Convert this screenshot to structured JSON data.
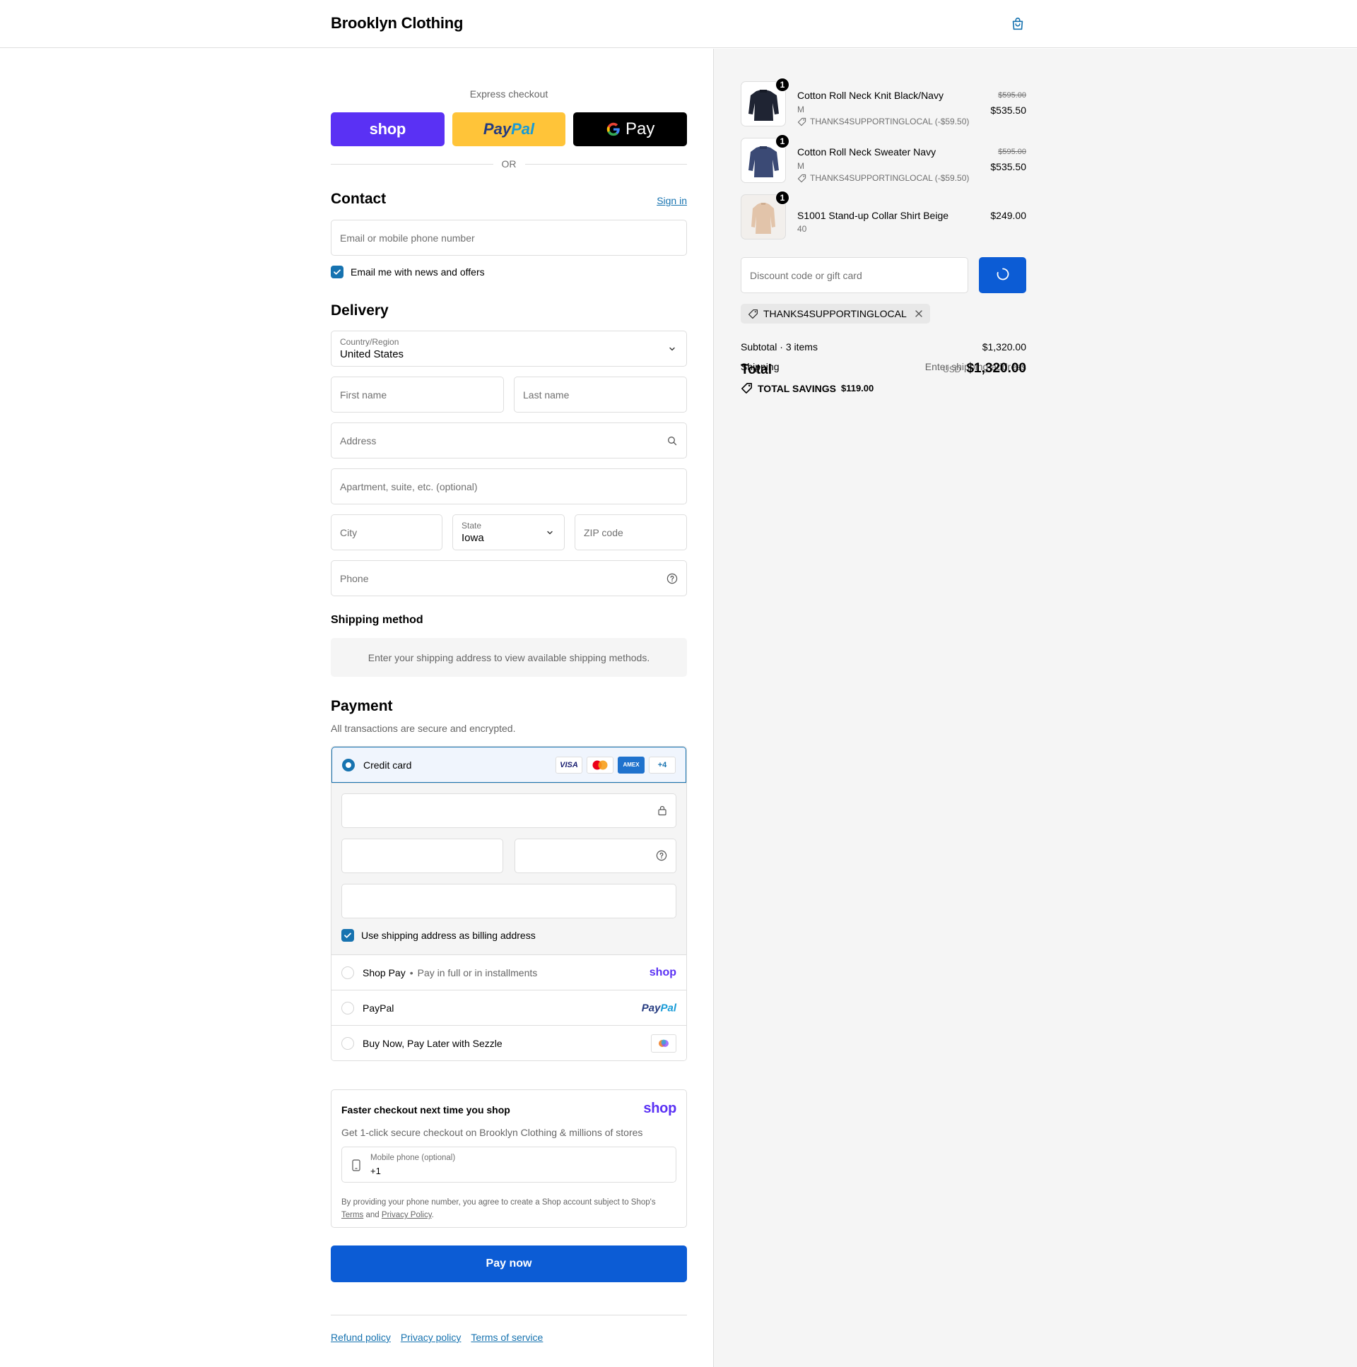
{
  "header": {
    "brand": "Brooklyn Clothing",
    "cart_icon": "shopping-bag-icon"
  },
  "express": {
    "title": "Express checkout",
    "shop_label": "shop",
    "paypal_label_a": "Pay",
    "paypal_label_b": "Pal",
    "gpay_label": "Pay",
    "or_label": "OR"
  },
  "contact": {
    "title": "Contact",
    "sign_in": "Sign in",
    "email_placeholder": "Email or mobile phone number",
    "news_label": "Email me with news and offers",
    "news_checked": true
  },
  "delivery": {
    "title": "Delivery",
    "country_label": "Country/Region",
    "country_value": "United States",
    "first_name_placeholder": "First name",
    "last_name_placeholder": "Last name",
    "address_placeholder": "Address",
    "apartment_placeholder": "Apartment, suite, etc. (optional)",
    "city_placeholder": "City",
    "state_label": "State",
    "state_value": "Iowa",
    "zip_placeholder": "ZIP code",
    "phone_placeholder": "Phone"
  },
  "shipping_method": {
    "title": "Shipping method",
    "message": "Enter your shipping address to view available shipping methods."
  },
  "payment": {
    "title": "Payment",
    "subtitle": "All transactions are secure and encrypted.",
    "options": [
      {
        "label": "Credit card",
        "selected": true
      },
      {
        "label": "Shop Pay",
        "sub": "Pay in full or in installments",
        "logo": "shop"
      },
      {
        "label": "PayPal",
        "logo_a": "Pay",
        "logo_b": "Pal"
      },
      {
        "label": "Buy Now, Pay Later with Sezzle"
      }
    ],
    "card_logos": [
      "VISA",
      "AMEX",
      "+4"
    ],
    "billing_label": "Use shipping address as billing address",
    "billing_checked": true
  },
  "shop_promo": {
    "title": "Faster checkout next time you shop",
    "logo": "shop",
    "description": "Get 1-click secure checkout on Brooklyn Clothing & millions of stores",
    "phone_label": "Mobile phone (optional)",
    "phone_value": "+1",
    "legal_prefix": "By providing your phone number, you agree to create a Shop account subject to Shop's",
    "terms": "Terms",
    "and": "and",
    "privacy": "Privacy Policy",
    "period": "."
  },
  "pay_now": "Pay now",
  "footer": {
    "links": [
      "Refund policy",
      "Privacy policy",
      "Terms of service"
    ]
  },
  "summary": {
    "items": [
      {
        "name": "Cotton Roll Neck Knit Black/Navy",
        "variant": "M",
        "discount": "THANKS4SUPPORTINGLOCAL (-$59.50)",
        "original_price": "$595.00",
        "price": "$535.50",
        "quantity": "1",
        "color": "#1f2433"
      },
      {
        "name": "Cotton Roll Neck Sweater Navy",
        "variant": "M",
        "discount": "THANKS4SUPPORTINGLOCAL (-$59.50)",
        "original_price": "$595.00",
        "price": "$535.50",
        "quantity": "1",
        "color": "#3b4a75"
      },
      {
        "name": "S1001 Stand-up Collar Shirt Beige",
        "variant": "40",
        "price": "$249.00",
        "quantity": "1",
        "color": "#e2c4aa"
      }
    ],
    "discount_placeholder": "Discount code or gift card",
    "applied_code": "THANKS4SUPPORTINGLOCAL",
    "subtotal_label": "Subtotal · 3 items",
    "subtotal_value": "$1,320.00",
    "shipping_label": "Shipping",
    "shipping_value": "Enter shipping address",
    "total_label": "Total",
    "currency": "USD",
    "total_value": "$1,320.00",
    "savings_label": "TOTAL SAVINGS",
    "savings_value": "$119.00"
  },
  "colors": {
    "accent": "#1773b0",
    "button": "#0c5cd5",
    "shop_purple": "#5a31f4",
    "paypal_yellow": "#ffc439"
  }
}
